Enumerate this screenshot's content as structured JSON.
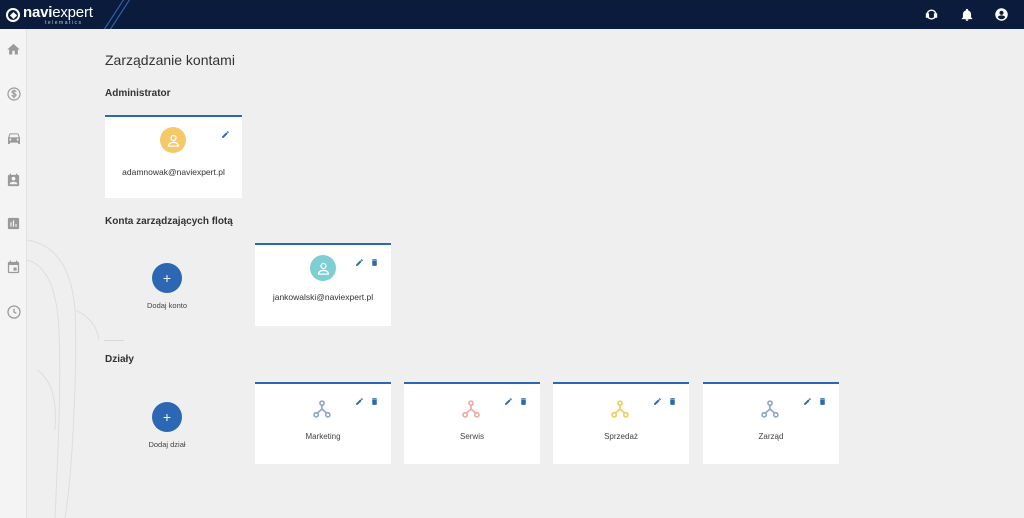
{
  "app": {
    "logo_bold": "navi",
    "logo_light": "expert",
    "logo_sub": "telematics"
  },
  "colors": {
    "accent": "#2b67b2",
    "topbar": "#0b1b3c",
    "avatar_admin": "#f5c86a",
    "avatar_fleet": "#7dcfd3"
  },
  "topbar": {
    "icons": [
      "headset-icon",
      "bell-icon",
      "account-icon"
    ]
  },
  "sidebar": {
    "icons": [
      "home-icon",
      "dollar-icon",
      "car-icon",
      "contacts-icon",
      "chart-icon",
      "calendar-icon",
      "clock-icon"
    ]
  },
  "main": {
    "title": "Zarządzanie kontami",
    "admin_section": "Administrator",
    "admin_email": "adamnowak@naviexpert.pl",
    "fleet_section": "Konta zarządzających flotą",
    "add_account": "Dodaj konto",
    "fleet_email": "jankowalski@naviexpert.pl",
    "departments_section": "Działy",
    "add_department": "Dodaj dział",
    "departments": [
      {
        "name": "Marketing",
        "color": "#8fa6cc"
      },
      {
        "name": "Serwis",
        "color": "#f2a9a2"
      },
      {
        "name": "Sprzedaż",
        "color": "#f2cb5e"
      },
      {
        "name": "Zarząd",
        "color": "#8fa6cc"
      }
    ],
    "fab_symbol": "+"
  }
}
